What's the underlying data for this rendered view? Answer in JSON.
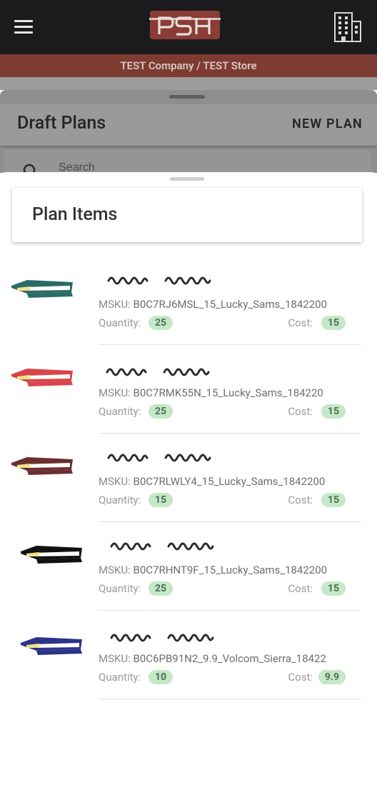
{
  "header": {
    "logo_text": "PSH",
    "menu_icon": "hamburger-menu-icon",
    "store_icon": "building-icon"
  },
  "context": {
    "label": "TEST Company / TEST Store"
  },
  "draft_plans": {
    "title": "Draft Plans",
    "new_plan_label": "NEW PLAN",
    "search_placeholder": "Search"
  },
  "plan_items": {
    "title": "Plan Items",
    "sku_label": "MSKU:",
    "quantity_label": "Quantity:",
    "cost_label": "Cost:",
    "items": [
      {
        "book_color": "#2a6b68",
        "sku": "B0C7RJ6MSL_15_Lucky_Sams_1842200",
        "quantity": "25",
        "cost": "15"
      },
      {
        "book_color": "#d9454b",
        "sku": "B0C7RMK55N_15_Lucky_Sams_184220",
        "quantity": "25",
        "cost": "15"
      },
      {
        "book_color": "#6b2e2e",
        "sku": "B0C7RLWLY4_15_Lucky_Sams_1842200",
        "quantity": "15",
        "cost": "15"
      },
      {
        "book_color": "#111111",
        "sku": "B0C7RHNT9F_15_Lucky_Sams_1842200",
        "quantity": "25",
        "cost": "15"
      },
      {
        "book_color": "#2c3389",
        "sku": "B0C6PB91N2_9.9_Volcom_Sierra_18422",
        "quantity": "10",
        "cost": "9.9"
      }
    ]
  },
  "colors": {
    "header_bg": "#1b1b1d",
    "context_bar_bg": "#7d3b32",
    "badge_bg": "#c5e8c8",
    "badge_text": "#4e6f50"
  }
}
